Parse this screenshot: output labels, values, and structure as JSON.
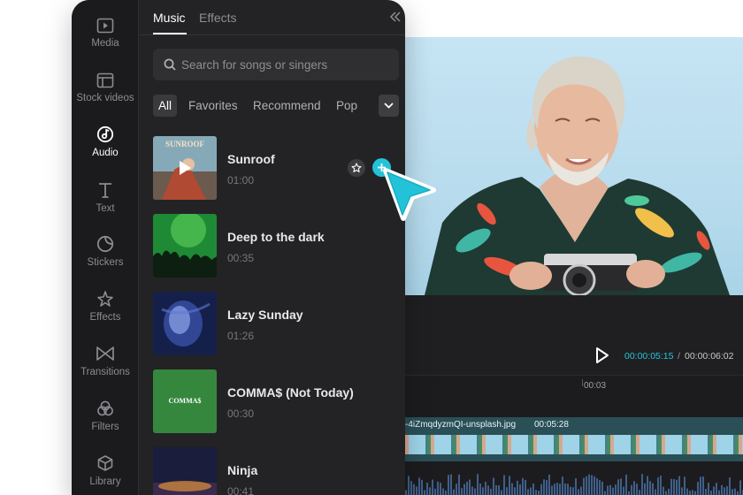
{
  "panel": {
    "rail": [
      {
        "label": "Media",
        "icon": "media-icon"
      },
      {
        "label": "Stock videos",
        "icon": "stock-videos-icon"
      },
      {
        "label": "Audio",
        "icon": "audio-icon",
        "active": true
      },
      {
        "label": "Text",
        "icon": "text-icon"
      },
      {
        "label": "Stickers",
        "icon": "stickers-icon"
      },
      {
        "label": "Effects",
        "icon": "effects-icon"
      },
      {
        "label": "Transitions",
        "icon": "transitions-icon"
      },
      {
        "label": "Filters",
        "icon": "filters-icon"
      },
      {
        "label": "Library",
        "icon": "library-icon"
      }
    ],
    "tabs": [
      {
        "label": "Music",
        "active": true
      },
      {
        "label": "Effects",
        "active": false
      }
    ],
    "search": {
      "placeholder": "Search for songs or singers",
      "value": ""
    },
    "filters": [
      {
        "label": "All",
        "active": true
      },
      {
        "label": "Favorites"
      },
      {
        "label": "Recommend"
      },
      {
        "label": "Pop"
      }
    ],
    "songs": [
      {
        "title": "Sunroof",
        "duration": "01:00",
        "cover_text": "SUNROOF"
      },
      {
        "title": "Deep to the dark",
        "duration": "00:35"
      },
      {
        "title": "Lazy Sunday",
        "duration": "01:26"
      },
      {
        "title": "COMMA$ (Not Today)",
        "duration": "00:30",
        "cover_text": "COMMA$"
      },
      {
        "title": "Ninja",
        "duration": "00:41"
      }
    ]
  },
  "editor": {
    "time_current": "00:00:05:15",
    "time_separator": "/",
    "time_total": "00:00:06:02",
    "ruler_mark": "00:03",
    "clip": {
      "name": "-4iZmqdyzmQI-unsplash.jpg",
      "duration": "00:05:28"
    }
  },
  "colors": {
    "accent": "#22c3d8",
    "panel_bg": "#232325",
    "rail_bg": "#1b1b1d",
    "timecode": "#27c5dc"
  }
}
